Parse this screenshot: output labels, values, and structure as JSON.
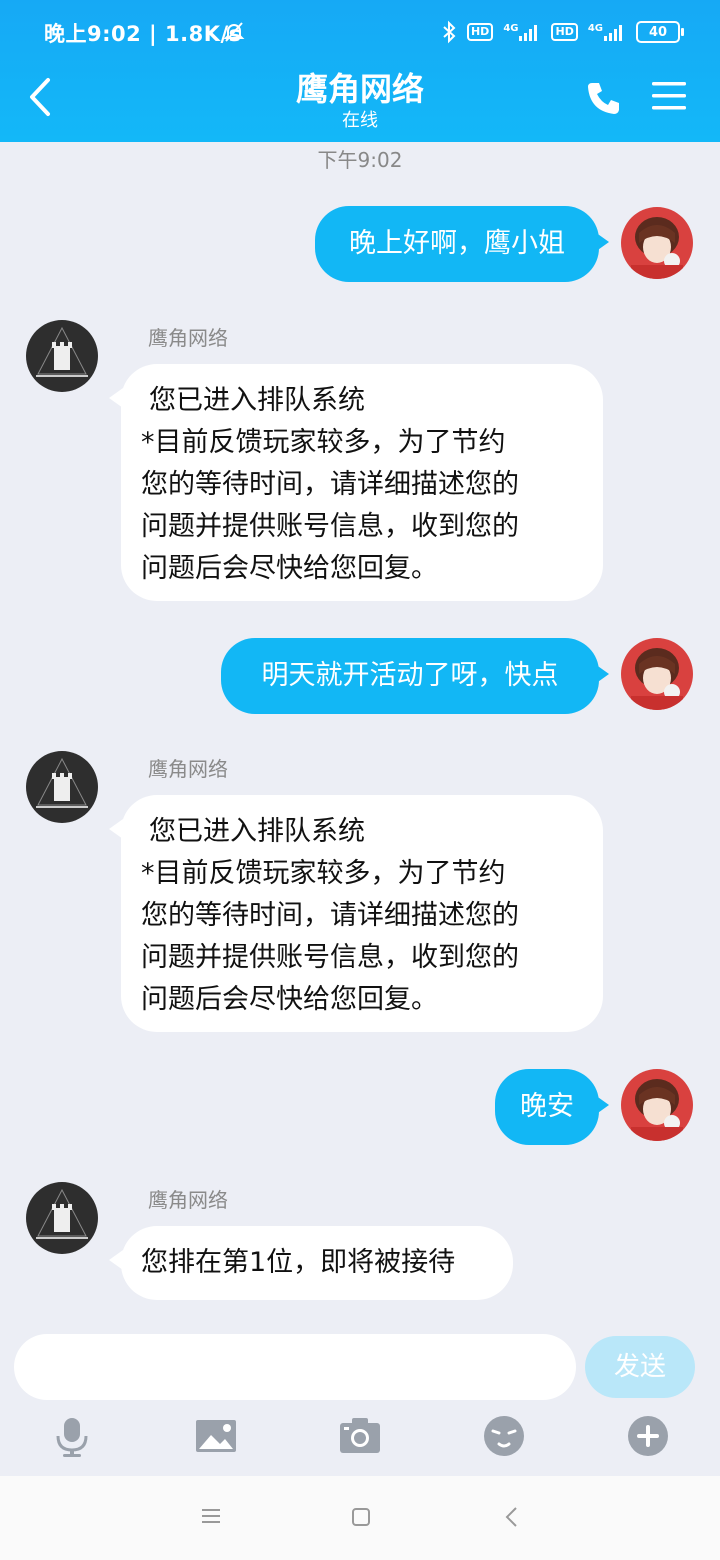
{
  "status_bar": {
    "left_text": "晚上9:02 | 1.8K/s",
    "sim1": "4G",
    "sim2": "4G",
    "hd": "HD",
    "battery": "40"
  },
  "header": {
    "title": "鹰角网络",
    "subtitle": "在线"
  },
  "chat": {
    "timestamp": "下午9:02",
    "contact_name": "鹰角网络",
    "messages": [
      {
        "from": "me",
        "text": "晚上好啊，鹰小姐"
      },
      {
        "from": "them",
        "name": "鹰角网络",
        "lines": [
          "您已进入排队系统",
          "*目前反馈玩家较多，为了节约",
          "您的等待时间，请详细描述您的",
          "问题并提供账号信息，收到您的",
          "问题后会尽快给您回复。"
        ]
      },
      {
        "from": "me",
        "text": "明天就开活动了呀，快点"
      },
      {
        "from": "them",
        "name": "鹰角网络",
        "lines": [
          "您已进入排队系统",
          "*目前反馈玩家较多，为了节约",
          "您的等待时间，请详细描述您的",
          "问题并提供账号信息，收到您的",
          "问题后会尽快给您回复。"
        ]
      },
      {
        "from": "me",
        "text": "晚安"
      },
      {
        "from": "them",
        "name": "鹰角网络",
        "text": "您排在第1位，即将被接待"
      }
    ]
  },
  "composer": {
    "input_value": "",
    "send_label": "发送"
  },
  "toolbar": {
    "icons": [
      "microphone-icon",
      "image-icon",
      "camera-icon",
      "emoji-icon",
      "plus-icon"
    ]
  },
  "colors": {
    "header": "#16a9f5",
    "outgoing_bubble": "#12b7f5",
    "incoming_bubble": "#ffffff",
    "background": "#eceef5",
    "send_disabled": "#b9e7f9"
  }
}
